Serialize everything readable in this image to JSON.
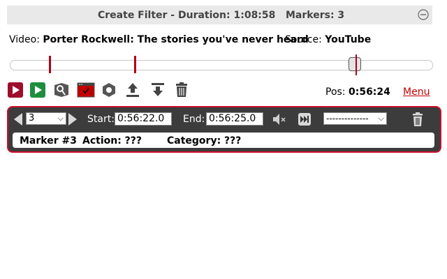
{
  "header": {
    "title": "Create Filter - Duration: 1:08:58",
    "markers": "Markers: 3",
    "collapse_icon": "minus-circle-icon"
  },
  "info": {
    "video_label": "Video:",
    "video_title": "Porter Rockwell: The stories you've never heard",
    "source_label": "Source:",
    "source_value": "YouTube"
  },
  "timeline": {
    "accent_color": "#b0001a"
  },
  "toolbar": {
    "icons": [
      "play-red-icon",
      "play-green-icon",
      "search-marker-icon",
      "window-check-icon",
      "gear-icon",
      "upload-icon",
      "download-icon",
      "trash-icon"
    ],
    "pos_label": "Pos:",
    "pos_value": "0:56:24",
    "menu_label": "Menu"
  },
  "editor": {
    "marker_select": "3",
    "start_label": "Start:",
    "start_value": "0:56:22.0",
    "end_label": "End:",
    "end_value": "0:56:25.0",
    "action_select": "--------------",
    "border_color": "#c8102e",
    "marker_label": "Marker #3",
    "action_label": "Action: ???",
    "category_label": "Category: ???"
  }
}
